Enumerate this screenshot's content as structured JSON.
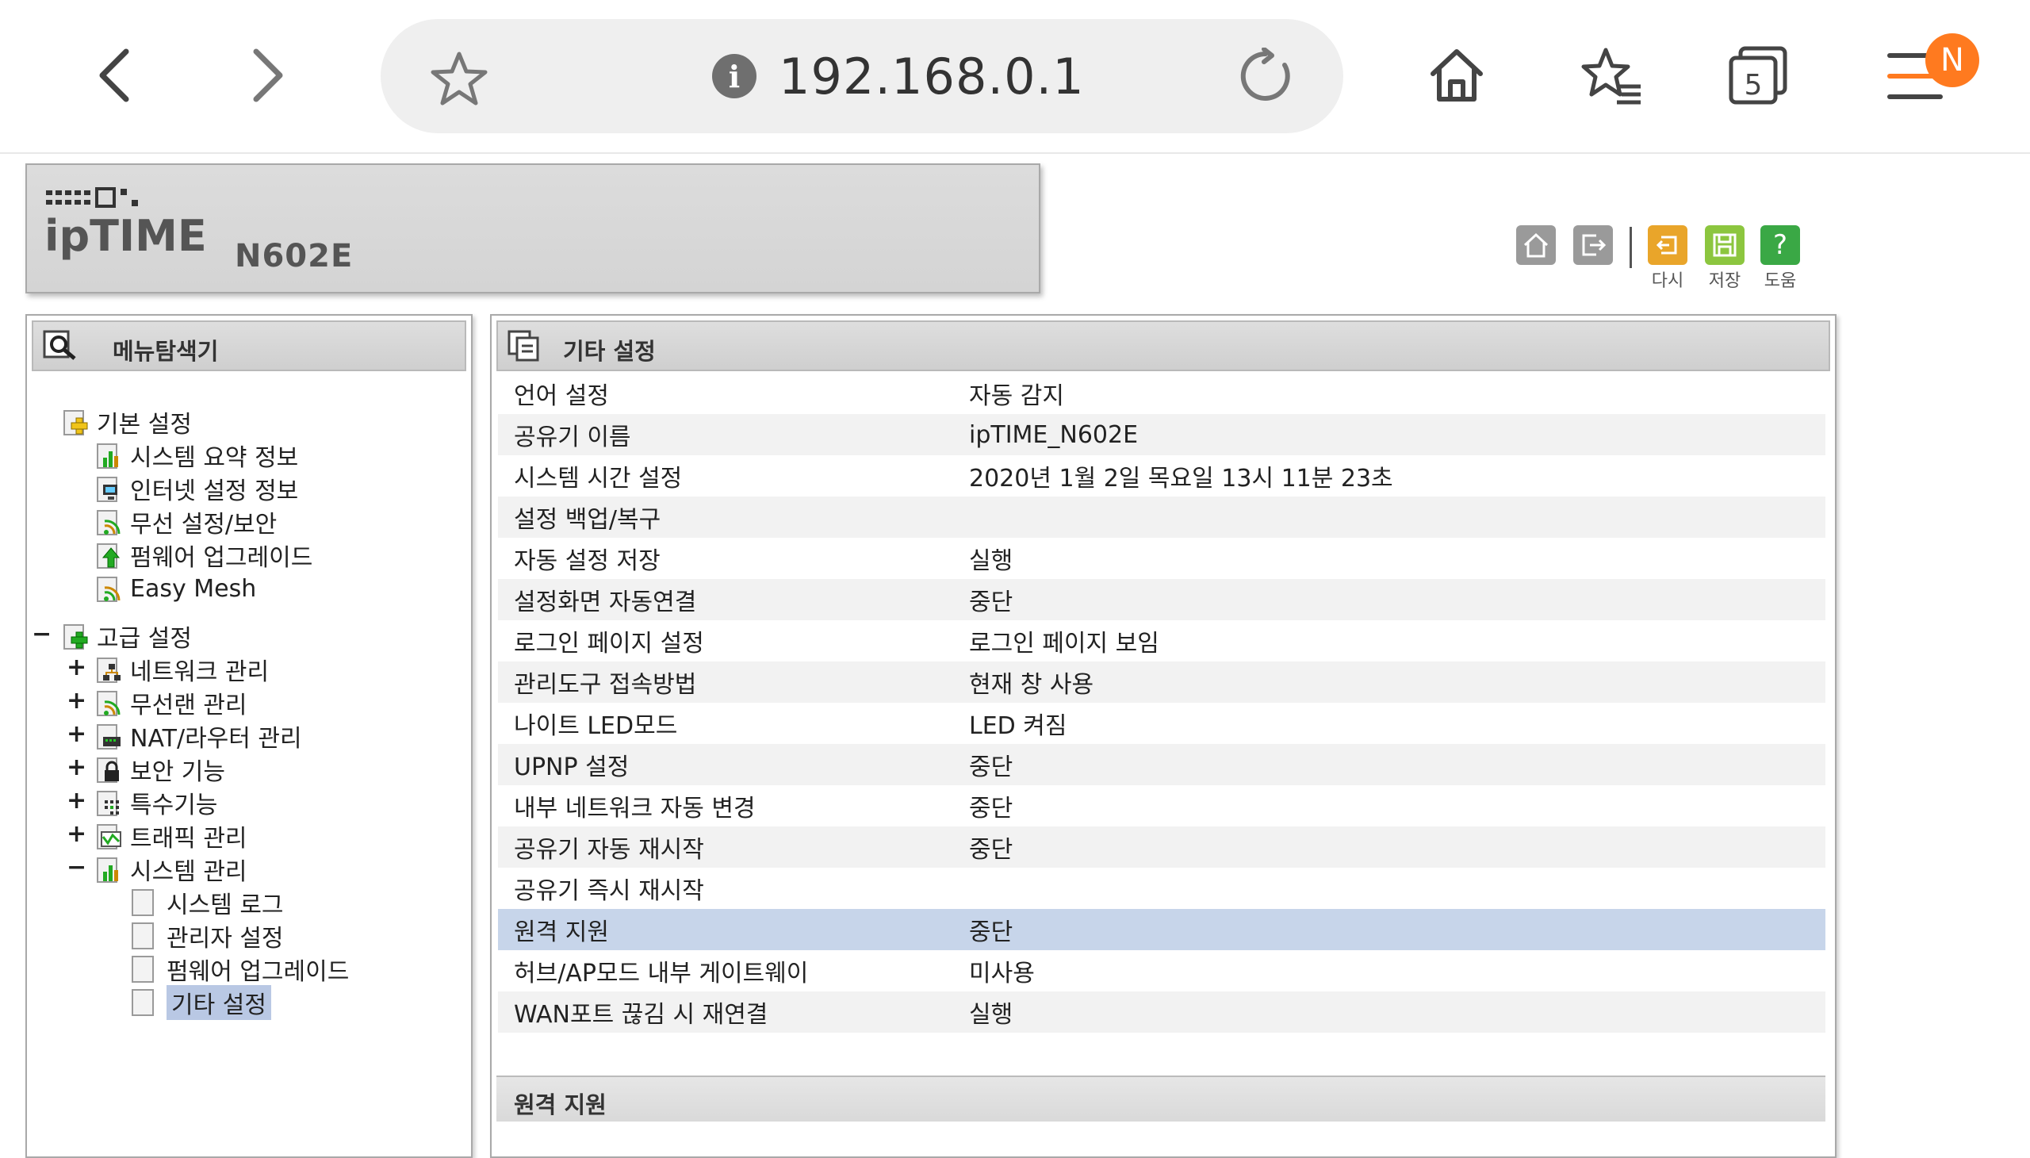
{
  "browser": {
    "url": "192.168.0.1",
    "tabs_count": "5",
    "profile_badge": "N",
    "accent_color": "#ff7a1f"
  },
  "router": {
    "brand": "ipTIME",
    "model": "N602E",
    "header_buttons": [
      {
        "icon": "home-icon",
        "label": ""
      },
      {
        "icon": "logout-icon",
        "label": ""
      },
      {
        "icon": "reload-config-icon",
        "label": "다시"
      },
      {
        "icon": "save-icon",
        "label": "저장"
      },
      {
        "icon": "help-icon",
        "label": "도움"
      }
    ]
  },
  "menu": {
    "title": "메뉴탐색기",
    "basic": {
      "label": "기본 설정",
      "items": [
        "시스템 요약 정보",
        "인터넷 설정 정보",
        "무선 설정/보안",
        "펌웨어 업그레이드",
        "Easy Mesh"
      ]
    },
    "advanced": {
      "toggle": "−",
      "label": "고급 설정",
      "items": [
        {
          "toggle": "+",
          "label": "네트워크 관리"
        },
        {
          "toggle": "+",
          "label": "무선랜 관리"
        },
        {
          "toggle": "+",
          "label": "NAT/라우터 관리"
        },
        {
          "toggle": "+",
          "label": "보안 기능"
        },
        {
          "toggle": "+",
          "label": "특수기능"
        },
        {
          "toggle": "+",
          "label": "트래픽 관리"
        },
        {
          "toggle": "−",
          "label": "시스템 관리"
        }
      ],
      "system_children": [
        "시스템 로그",
        "관리자 설정",
        "펌웨어 업그레이드",
        "기타 설정"
      ]
    }
  },
  "content": {
    "title": "기타 설정",
    "rows": [
      {
        "key": "언어 설정",
        "value": "자동 감지"
      },
      {
        "key": "공유기 이름",
        "value": "ipTIME_N602E"
      },
      {
        "key": "시스템 시간 설정",
        "value": "2020년 1월 2일 목요일 13시 11분 23초"
      },
      {
        "key": "설정 백업/복구",
        "value": ""
      },
      {
        "key": "자동 설정 저장",
        "value": "실행"
      },
      {
        "key": "설정화면 자동연결",
        "value": "중단"
      },
      {
        "key": "로그인 페이지 설정",
        "value": "로그인 페이지 보임"
      },
      {
        "key": "관리도구 접속방법",
        "value": "현재 창 사용"
      },
      {
        "key": "나이트 LED모드",
        "value": "LED 켜짐"
      },
      {
        "key": "UPNP 설정",
        "value": "중단"
      },
      {
        "key": "내부 네트워크 자동 변경",
        "value": "중단"
      },
      {
        "key": "공유기 자동 재시작",
        "value": "중단"
      },
      {
        "key": "공유기 즉시 재시작",
        "value": ""
      },
      {
        "key": "원격 지원",
        "value": "중단"
      },
      {
        "key": "허브/AP모드 내부 게이트웨이",
        "value": "미사용"
      },
      {
        "key": "WAN포트 끊김 시 재연결",
        "value": "실행"
      }
    ],
    "selected_row": "원격 지원",
    "sub_section_title": "원격 지원"
  }
}
